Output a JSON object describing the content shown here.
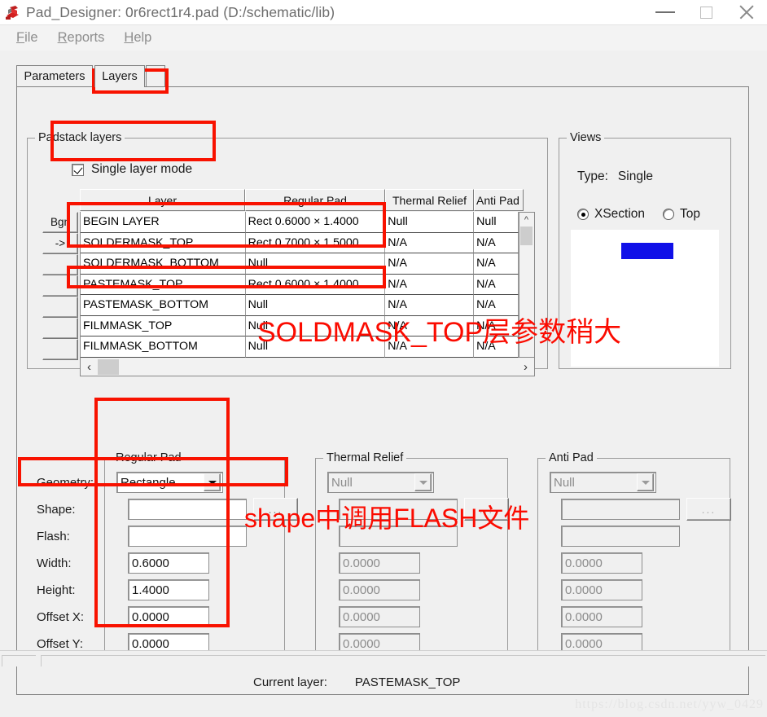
{
  "window": {
    "title": "Pad_Designer: 0r6rect1r4.pad (D:/schematic/lib)",
    "icon": "pad-designer-icon",
    "minimize": "minimize-icon",
    "maximize": "maximize-icon",
    "close": "close-icon"
  },
  "menubar": {
    "items": [
      {
        "label": "File",
        "accel": "F"
      },
      {
        "label": "Reports",
        "accel": "R"
      },
      {
        "label": "Help",
        "accel": "H"
      }
    ]
  },
  "tabs": [
    {
      "label": "Parameters",
      "active": false
    },
    {
      "label": "Layers",
      "active": true
    },
    {
      "label": "",
      "active": false
    }
  ],
  "padstack": {
    "group_label": "Padstack layers",
    "single_layer_mode": {
      "label": "Single layer mode",
      "checked": true
    },
    "table": {
      "columns": [
        "Layer",
        "Regular Pad",
        "Thermal Relief",
        "Anti Pad"
      ],
      "rows": [
        {
          "button": "Bgn",
          "layer": "BEGIN LAYER",
          "regular_pad": "Rect 0.6000 × 1.4000",
          "thermal_relief": "Null",
          "anti_pad": "Null"
        },
        {
          "button": "->",
          "layer": "SOLDERMASK_TOP",
          "regular_pad": "Rect 0.7000 × 1.5000",
          "thermal_relief": "N/A",
          "anti_pad": "N/A"
        },
        {
          "button": "",
          "layer": "SOLDERMASK_BOTTOM",
          "regular_pad": "Null",
          "thermal_relief": "N/A",
          "anti_pad": "N/A"
        },
        {
          "button": "",
          "layer": "PASTEMASK_TOP",
          "regular_pad": "Rect 0.6000 × 1.4000",
          "thermal_relief": "N/A",
          "anti_pad": "N/A"
        },
        {
          "button": "",
          "layer": "PASTEMASK_BOTTOM",
          "regular_pad": "Null",
          "thermal_relief": "N/A",
          "anti_pad": "N/A"
        },
        {
          "button": "",
          "layer": "FILMMASK_TOP",
          "regular_pad": "Null",
          "thermal_relief": "N/A",
          "anti_pad": "N/A"
        },
        {
          "button": "",
          "layer": "FILMMASK_BOTTOM",
          "regular_pad": "Null",
          "thermal_relief": "N/A",
          "anti_pad": "N/A"
        }
      ]
    },
    "scroll": {
      "up_arrow": "chevron-up-icon",
      "down_arrow": "chevron-down-icon",
      "left_arrow": "chevron-left-icon",
      "right_arrow": "chevron-right-icon"
    }
  },
  "views": {
    "group_label": "Views",
    "type_label": "Type:",
    "type_value": "Single",
    "radios": [
      {
        "label": "XSection",
        "selected": true
      },
      {
        "label": "Top",
        "selected": false
      }
    ],
    "preview_pad_color": "#1010e8"
  },
  "form": {
    "labels": [
      "Geometry:",
      "Shape:",
      "Flash:",
      "Width:",
      "Height:",
      "Offset X:",
      "Offset Y:"
    ],
    "regular_pad": {
      "group_label": "Regular Pad",
      "geometry": "Rectangle",
      "shape": "",
      "flash": "",
      "width": "0.6000",
      "height": "1.4000",
      "offset_x": "0.0000",
      "offset_y": "0.0000",
      "browse_button": "..."
    },
    "thermal_relief": {
      "group_label": "Thermal Relief",
      "geometry": "Null",
      "shape": "",
      "flash": "",
      "width": "0.0000",
      "height": "0.0000",
      "offset_x": "0.0000",
      "offset_y": "0.0000",
      "browse_button": "..."
    },
    "anti_pad": {
      "group_label": "Anti Pad",
      "geometry": "Null",
      "shape": "",
      "flash": "",
      "width": "0.0000",
      "height": "0.0000",
      "offset_x": "0.0000",
      "offset_y": "0.0000",
      "browse_button": "..."
    }
  },
  "status": {
    "current_layer_label": "Current layer:",
    "current_layer_value": "PASTEMASK_TOP"
  },
  "annotations": {
    "note_soldermask": "SOLDMASK_TOP层参数稍大",
    "note_shape": "shape中调用FLASH文件",
    "color": "#fb0b00"
  },
  "watermark": "https://blog.csdn.net/yyw_0429"
}
